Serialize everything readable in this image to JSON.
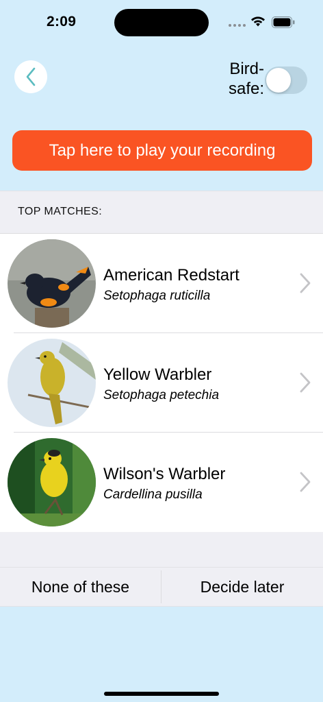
{
  "status": {
    "time": "2:09"
  },
  "header": {
    "birdsafe_label": "Bird-\nsafe:",
    "birdsafe_on": false
  },
  "play_button": {
    "label": "Tap here to play your recording"
  },
  "matches": {
    "title": "TOP MATCHES:",
    "items": [
      {
        "common_name": "American Redstart",
        "scientific_name": "Setophaga ruticilla"
      },
      {
        "common_name": "Yellow Warbler",
        "scientific_name": "Setophaga petechia"
      },
      {
        "common_name": "Wilson's Warbler",
        "scientific_name": "Cardellina pusilla"
      }
    ]
  },
  "actions": {
    "none_label": "None of these",
    "later_label": "Decide later"
  },
  "colors": {
    "accent": "#fa5423",
    "background": "#d3edfb",
    "chevron": "#c4c4c7"
  },
  "icons": [
    "back-chevron-icon",
    "chevron-right-icon",
    "wifi-icon",
    "battery-icon"
  ]
}
